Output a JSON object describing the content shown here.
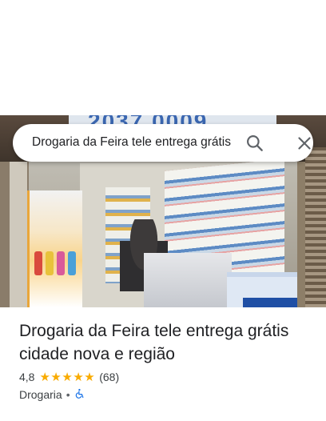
{
  "search": {
    "query": "Drogaria da Feira tele entrega grátis",
    "search_icon": "search-icon",
    "close_icon": "close-icon"
  },
  "place": {
    "title": "Drogaria da Feira tele entrega grátis cidade nova e região",
    "rating": "4,8",
    "stars": 5,
    "review_count": "(68)",
    "category": "Drogaria",
    "separator": "•",
    "accessibility_icon": "wheelchair-icon"
  },
  "photo": {
    "sign_text": "2037 0009"
  },
  "colors": {
    "star": "#f9ab00",
    "accessibility": "#1a73e8",
    "text_primary": "#202124",
    "text_secondary": "#3c4043"
  }
}
